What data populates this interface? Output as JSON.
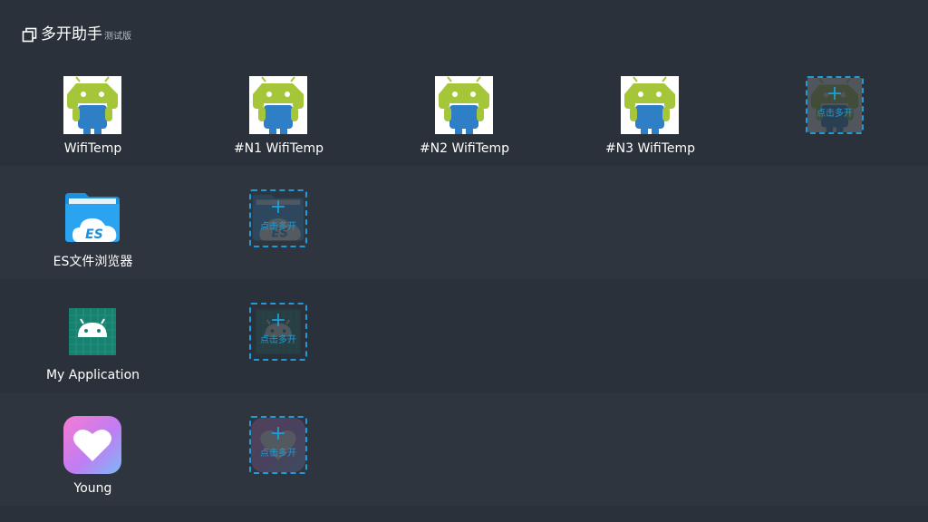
{
  "header": {
    "icon": "multi-window-icon",
    "title": "多开助手",
    "subtitle": "测试版"
  },
  "rows": [
    {
      "app": {
        "name": "WifiTemp",
        "icon": "android-robot-icon"
      },
      "clones": [
        "#N1 WifiTemp",
        "#N2 WifiTemp",
        "#N3 WifiTemp"
      ],
      "add_label": "点击多开"
    },
    {
      "app": {
        "name": "ES文件浏览器",
        "icon": "es-file-explorer-icon"
      },
      "clones": [],
      "add_label": "点击多开"
    },
    {
      "app": {
        "name": "My Application",
        "icon": "android-app-icon"
      },
      "clones": [],
      "add_label": "点击多开"
    },
    {
      "app": {
        "name": "Young",
        "icon": "heart-app-icon"
      },
      "clones": [],
      "add_label": "点击多开"
    }
  ],
  "add_symbol": "+",
  "colors": {
    "background": "#2b313a",
    "row_alt": "#2f353e",
    "accent": "#1e9cd7"
  }
}
